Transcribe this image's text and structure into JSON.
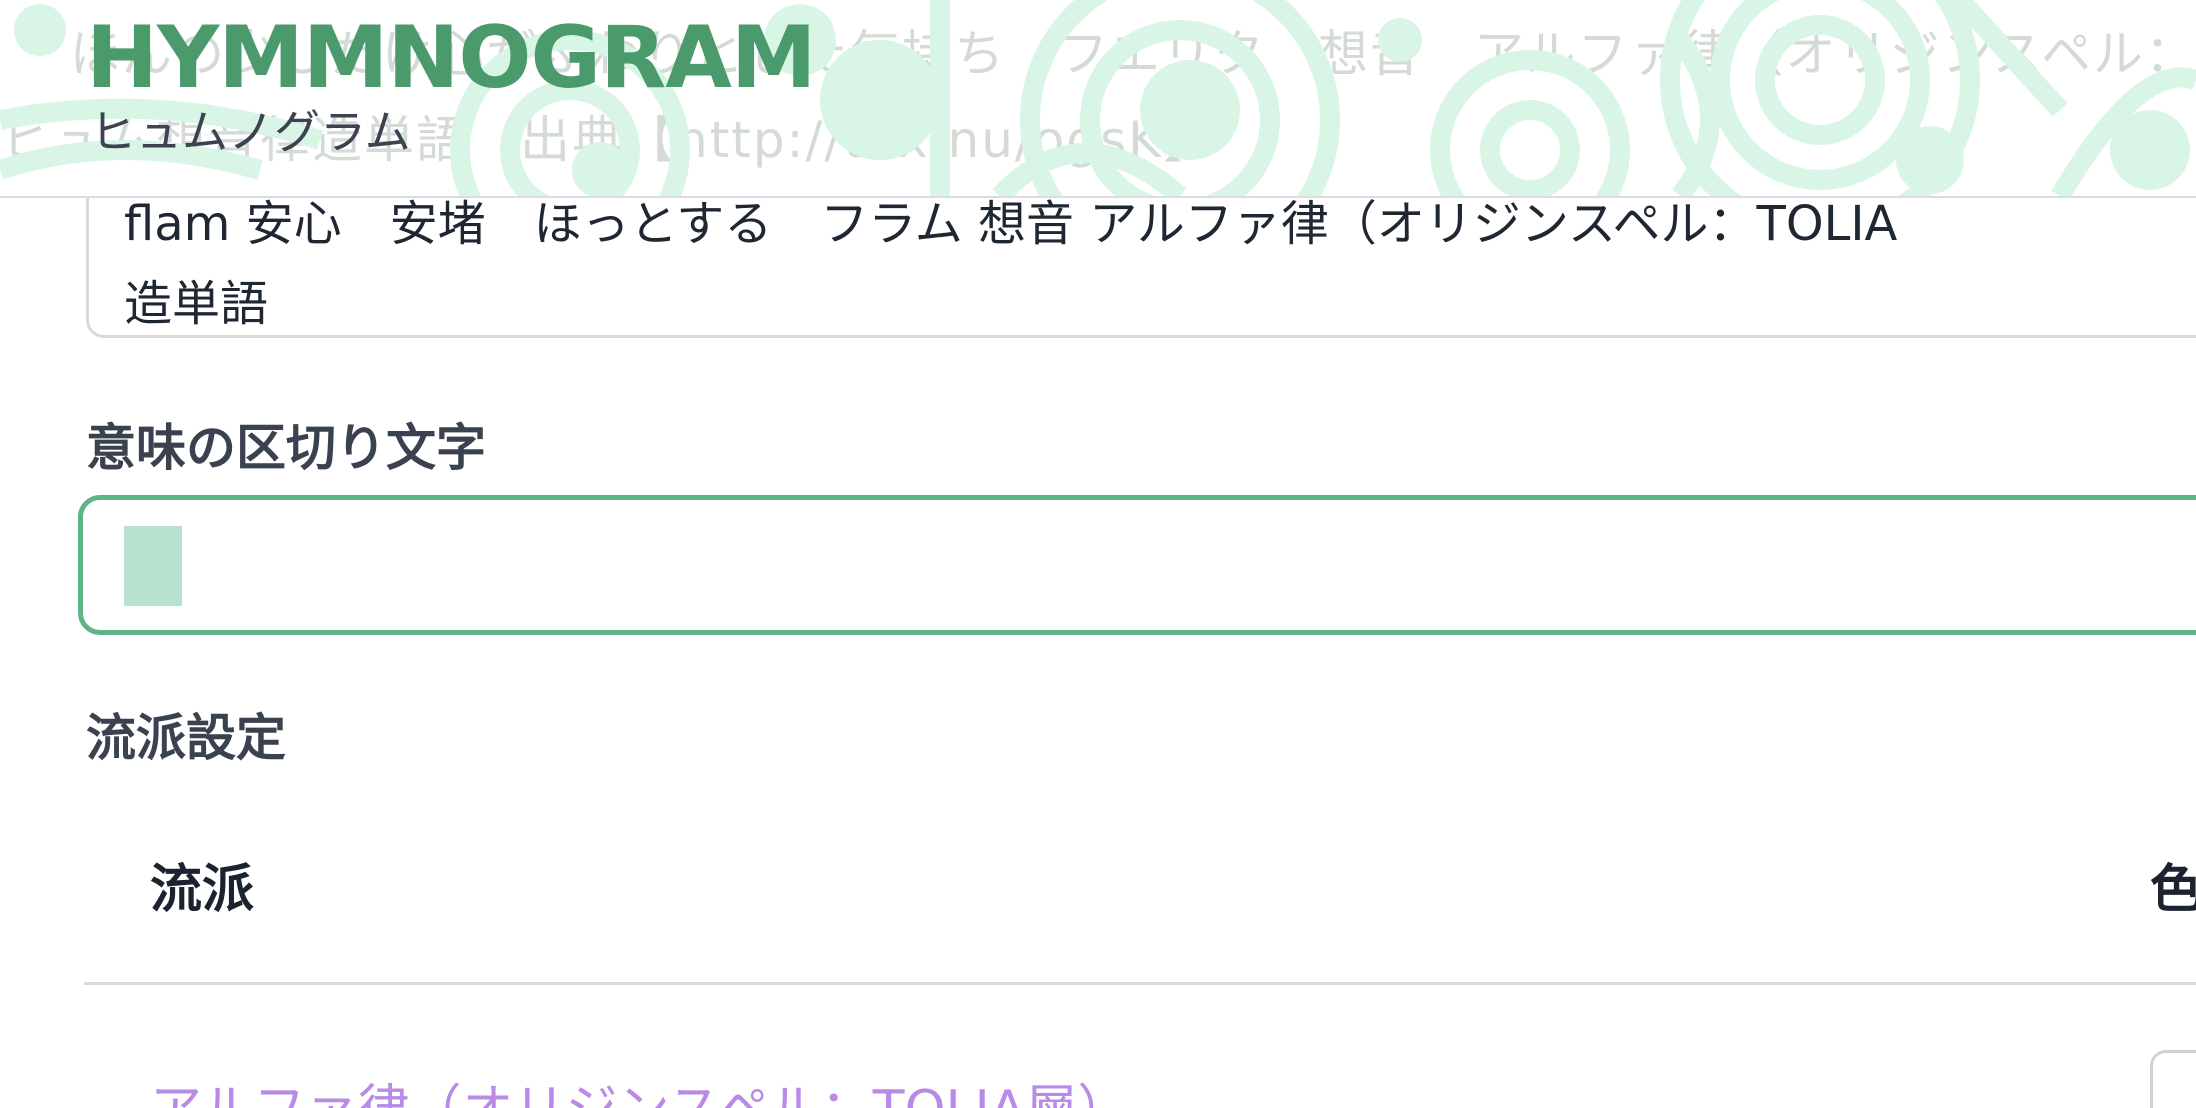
{
  "header": {
    "logo": "HYMMNOGRAM",
    "logo_sub": "ヒュムノグラム",
    "bg_line1": "ほんの少しだけ心がふわりとした気持ち　フエリタ　想音　アルファ律（オリジンスペル：TOLIA層）",
    "bg_line2": "ヒュム想音律造単語　出典【http://urx.nu/ogsK】"
  },
  "main": {
    "textarea_line1": "flam  安心　安堵　ほっとする　フラム  想音  アルファ律（オリジンスペル：TOLIA",
    "textarea_line2": "造単語",
    "separator_label": "意味の区切り文字",
    "separator_value": "",
    "style_section_label": "流派設定",
    "table": {
      "col_style": "流派",
      "col_color": "色",
      "rows": [
        {
          "style": "アルファ律（オリジンスペル：TOLIA層）"
        }
      ]
    }
  },
  "colors": {
    "accent": "#5db585",
    "logo": "#4a9a6c",
    "link": "#b98be6",
    "decoration": "#d8f5e6"
  }
}
